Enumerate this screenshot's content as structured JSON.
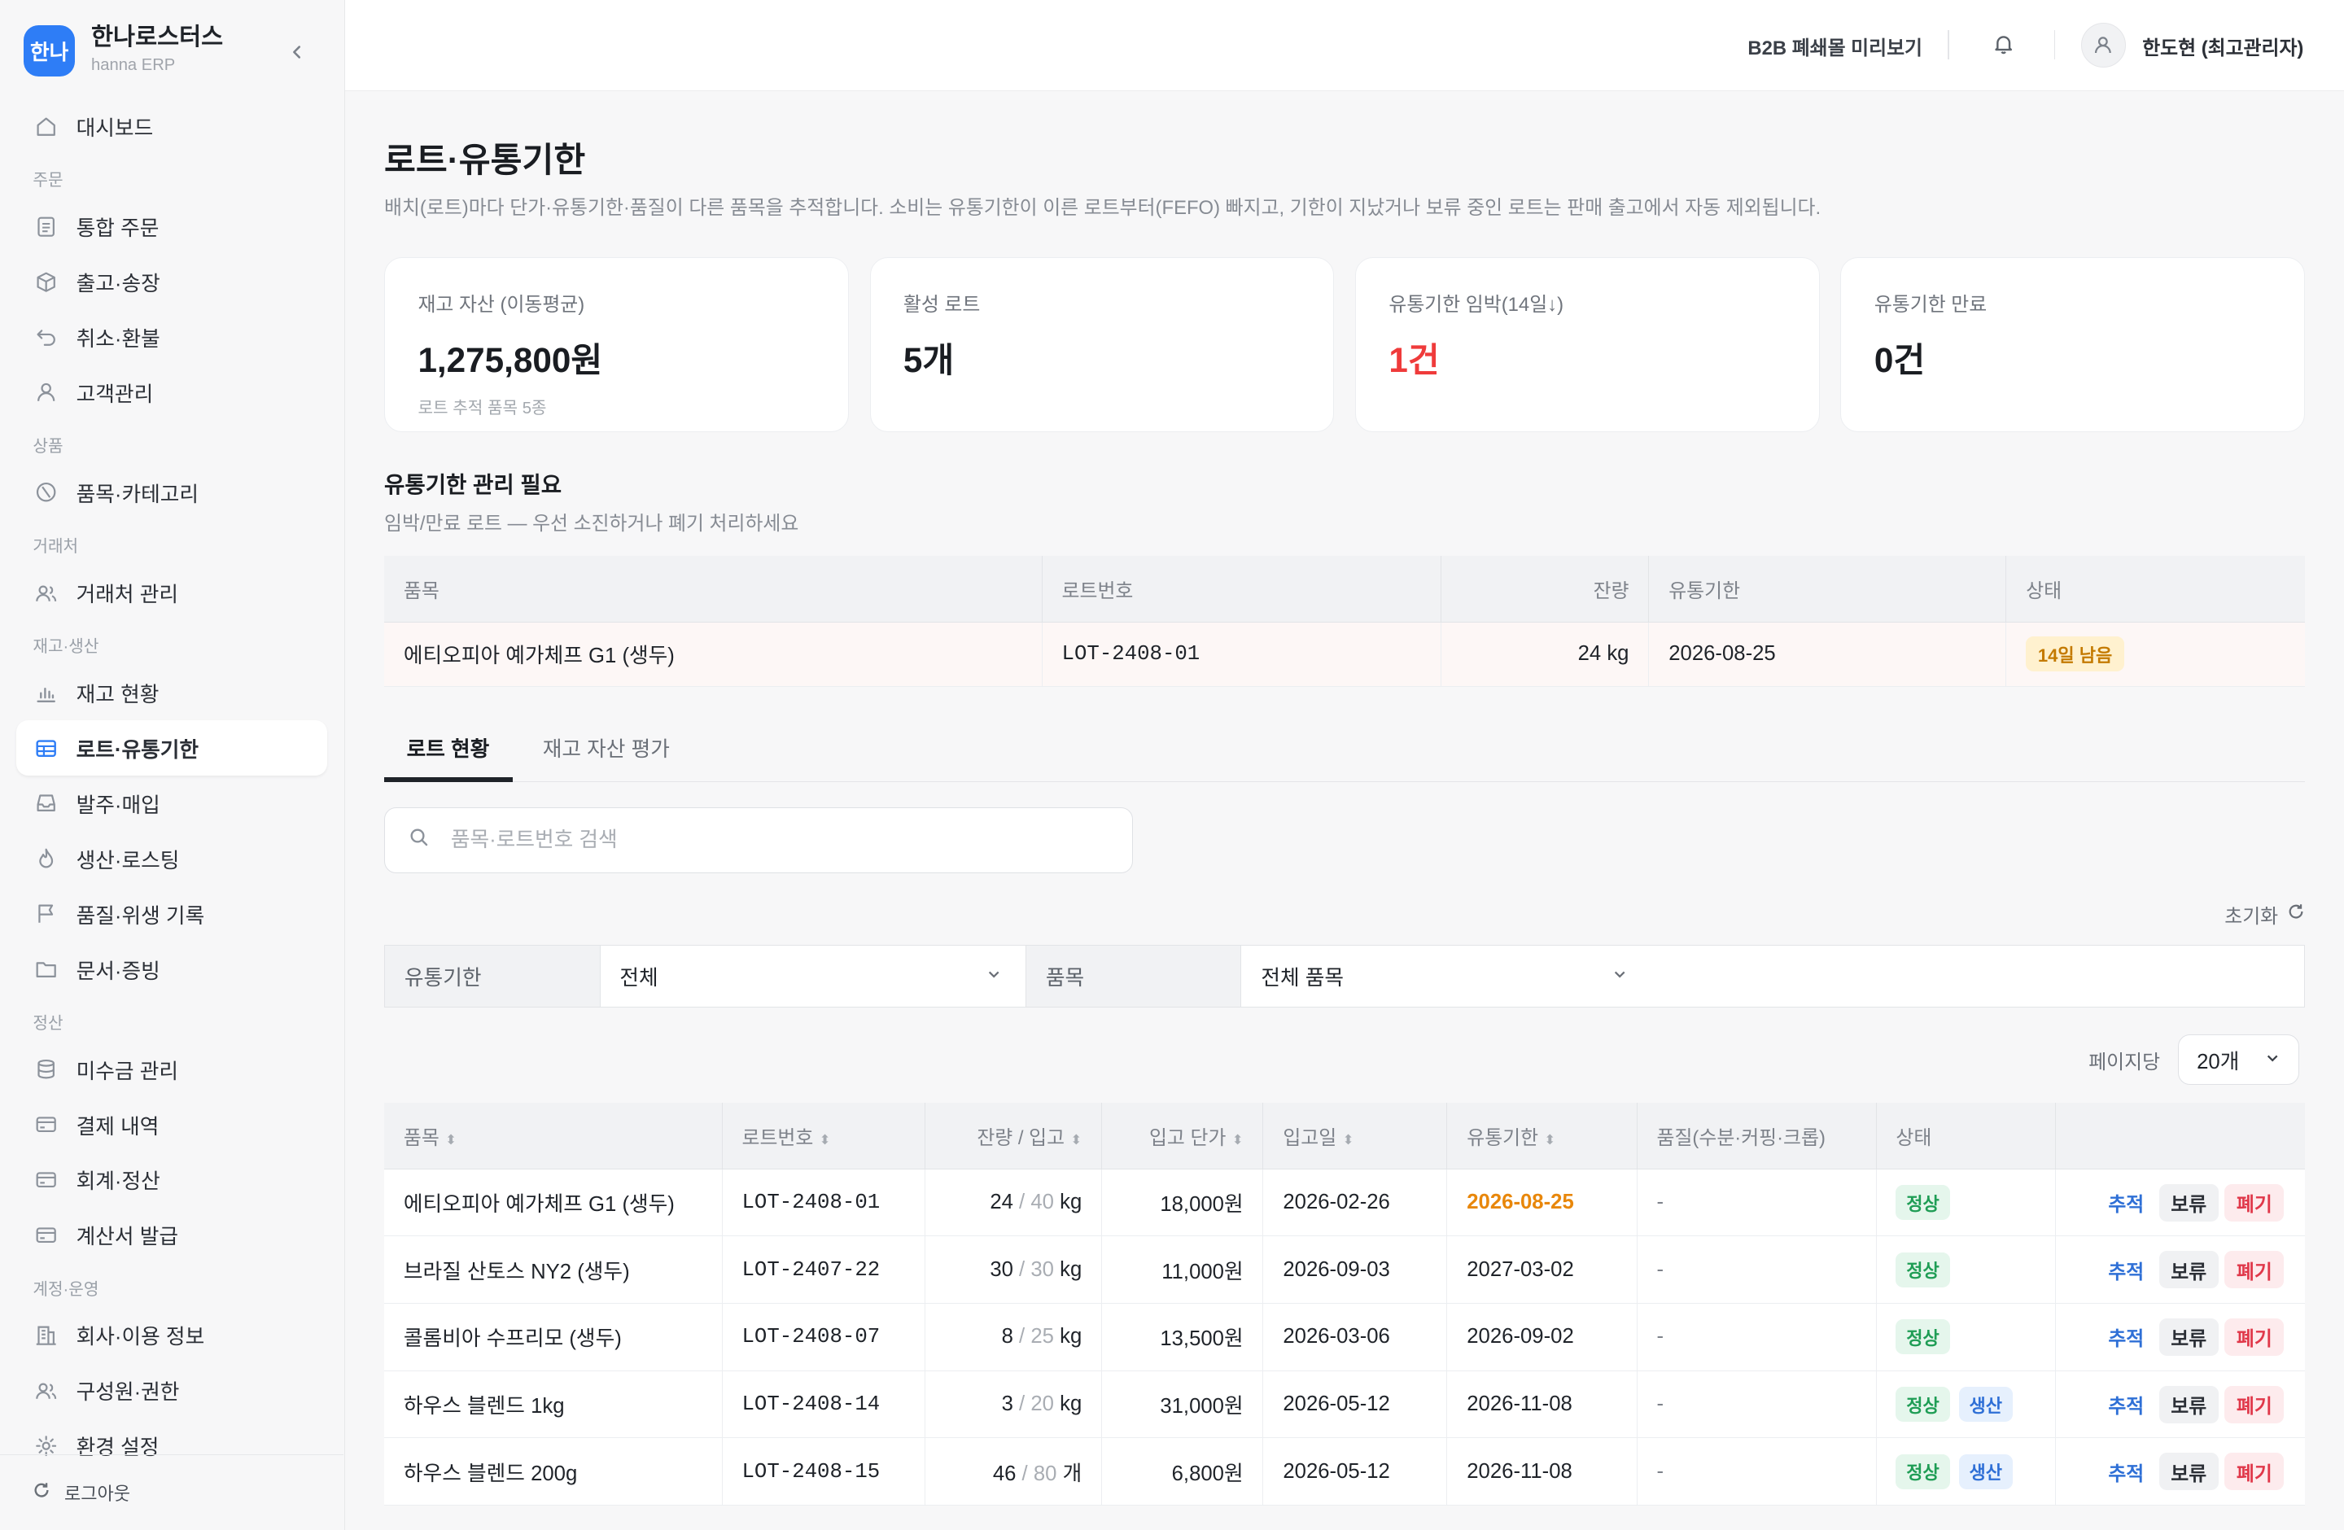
{
  "brand": {
    "logo": "한나",
    "name": "한나로스터스",
    "sub": "hanna ERP"
  },
  "sidebar": {
    "items": [
      {
        "type": "item",
        "label": "대시보드",
        "icon": "home-icon"
      },
      {
        "type": "section",
        "label": "주문"
      },
      {
        "type": "item",
        "label": "통합 주문",
        "icon": "document-icon"
      },
      {
        "type": "item",
        "label": "출고·송장",
        "icon": "box-icon"
      },
      {
        "type": "item",
        "label": "취소·환불",
        "icon": "undo-icon"
      },
      {
        "type": "item",
        "label": "고객관리",
        "icon": "user-icon"
      },
      {
        "type": "section",
        "label": "상품"
      },
      {
        "type": "item",
        "label": "품목·카테고리",
        "icon": "tag-icon"
      },
      {
        "type": "section",
        "label": "거래처"
      },
      {
        "type": "item",
        "label": "거래처 관리",
        "icon": "users-icon"
      },
      {
        "type": "section",
        "label": "재고·생산"
      },
      {
        "type": "item",
        "label": "재고 현황",
        "icon": "bar-chart-icon"
      },
      {
        "type": "item",
        "label": "로트·유통기한",
        "icon": "table-icon",
        "active": true
      },
      {
        "type": "item",
        "label": "발주·매입",
        "icon": "inbox-icon"
      },
      {
        "type": "item",
        "label": "생산·로스팅",
        "icon": "flame-icon"
      },
      {
        "type": "item",
        "label": "품질·위생 기록",
        "icon": "flag-icon"
      },
      {
        "type": "item",
        "label": "문서·증빙",
        "icon": "folder-icon"
      },
      {
        "type": "section",
        "label": "정산"
      },
      {
        "type": "item",
        "label": "미수금 관리",
        "icon": "database-icon"
      },
      {
        "type": "item",
        "label": "결제 내역",
        "icon": "card-icon"
      },
      {
        "type": "item",
        "label": "회계·정산",
        "icon": "card-icon"
      },
      {
        "type": "item",
        "label": "계산서 발급",
        "icon": "card-icon"
      },
      {
        "type": "section",
        "label": "계정·운영"
      },
      {
        "type": "item",
        "label": "회사·이용 정보",
        "icon": "building-icon"
      },
      {
        "type": "item",
        "label": "구성원·권한",
        "icon": "users-icon"
      },
      {
        "type": "item",
        "label": "환경 설정",
        "icon": "gear-icon"
      }
    ],
    "logout": "로그아웃"
  },
  "topbar": {
    "b2b_link": "B2B 폐쇄몰 미리보기",
    "user": "한도현 (최고관리자)"
  },
  "page": {
    "title": "로트·유통기한",
    "desc": "배치(로트)마다 단가·유통기한·품질이 다른 품목을 추적합니다. 소비는 유통기한이 이른 로트부터(FEFO) 빠지고, 기한이 지났거나 보류 중인 로트는 판매 출고에서 자동 제외됩니다."
  },
  "stats": [
    {
      "label": "재고 자산 (이동평균)",
      "value": "1,275,800원",
      "sub": "로트 추적 품목 5종",
      "color": ""
    },
    {
      "label": "활성 로트",
      "value": "5개",
      "sub": "",
      "color": ""
    },
    {
      "label": "유통기한 임박(14일↓)",
      "value": "1건",
      "sub": "",
      "color": "red"
    },
    {
      "label": "유통기한 만료",
      "value": "0건",
      "sub": "",
      "color": ""
    }
  ],
  "expiry_section": {
    "title": "유통기한 관리 필요",
    "desc": "임박/만료 로트 — 우선 소진하거나 폐기 처리하세요",
    "headers": [
      "품목",
      "로트번호",
      "잔량",
      "유통기한",
      "상태"
    ],
    "rows": [
      {
        "item": "에티오피아 예가체프 G1 (생두)",
        "lot": "LOT-2408-01",
        "qty": "24 kg",
        "expiry": "2026-08-25",
        "status": "14일 남음"
      }
    ]
  },
  "tabs": {
    "lots": "로트 현황",
    "valuation": "재고 자산 평가"
  },
  "search": {
    "placeholder": "품목·로트번호 검색"
  },
  "reset_label": "초기화",
  "filters": {
    "expiry_label": "유통기한",
    "expiry_value": "전체",
    "item_label": "품목",
    "item_value": "전체 품목"
  },
  "perpage": {
    "label": "페이지당",
    "value": "20개"
  },
  "lot_table": {
    "headers": [
      "품목",
      "로트번호",
      "잔량 / 입고",
      "입고 단가",
      "입고일",
      "유통기한",
      "품질(수분·커핑·크롭)",
      "상태"
    ],
    "actions": {
      "track": "추적",
      "hold": "보류",
      "discard": "폐기"
    },
    "rows": [
      {
        "item": "에티오피아 예가체프 G1 (생두)",
        "lot": "LOT-2408-01",
        "remain": "24",
        "inbound": "40",
        "unit": "kg",
        "price": "18,000원",
        "in_date": "2026-02-26",
        "expiry": "2026-08-25",
        "expiry_warn": true,
        "quality": "-",
        "status": "정상",
        "tag": ""
      },
      {
        "item": "브라질 산토스 NY2 (생두)",
        "lot": "LOT-2407-22",
        "remain": "30",
        "inbound": "30",
        "unit": "kg",
        "price": "11,000원",
        "in_date": "2026-09-03",
        "expiry": "2027-03-02",
        "expiry_warn": false,
        "quality": "-",
        "status": "정상",
        "tag": ""
      },
      {
        "item": "콜롬비아 수프리모 (생두)",
        "lot": "LOT-2408-07",
        "remain": "8",
        "inbound": "25",
        "unit": "kg",
        "price": "13,500원",
        "in_date": "2026-03-06",
        "expiry": "2026-09-02",
        "expiry_warn": false,
        "quality": "-",
        "status": "정상",
        "tag": ""
      },
      {
        "item": "하우스 블렌드 1kg",
        "lot": "LOT-2408-14",
        "remain": "3",
        "inbound": "20",
        "unit": "kg",
        "price": "31,000원",
        "in_date": "2026-05-12",
        "expiry": "2026-11-08",
        "expiry_warn": false,
        "quality": "-",
        "status": "정상",
        "tag": "생산"
      },
      {
        "item": "하우스 블렌드 200g",
        "lot": "LOT-2408-15",
        "remain": "46",
        "inbound": "80",
        "unit": "개",
        "price": "6,800원",
        "in_date": "2026-05-12",
        "expiry": "2026-11-08",
        "expiry_warn": false,
        "quality": "-",
        "status": "정상",
        "tag": "생산"
      }
    ]
  }
}
